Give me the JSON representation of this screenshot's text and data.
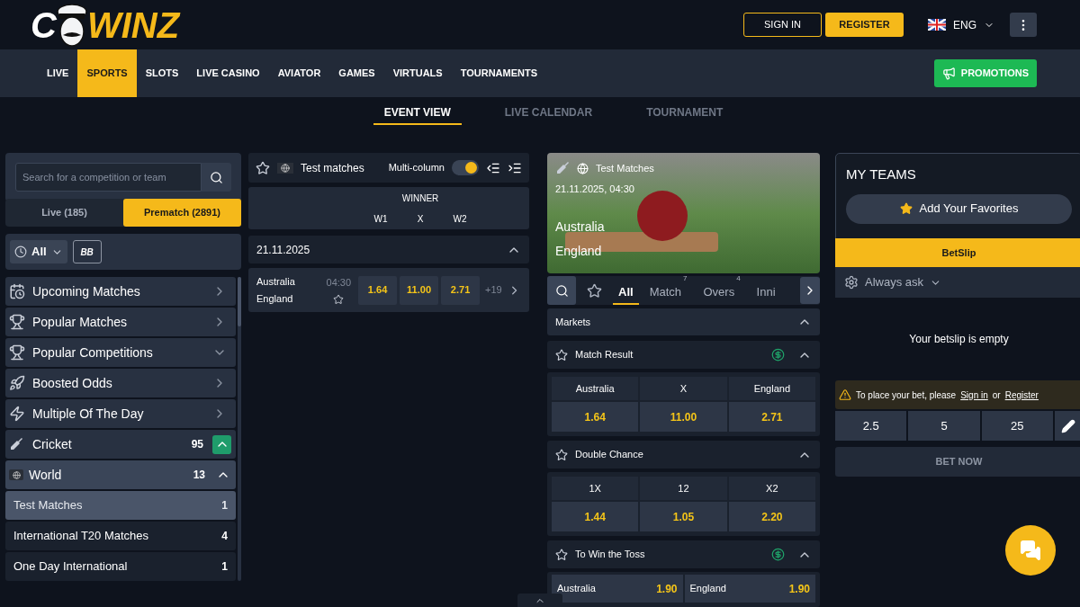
{
  "logo": {
    "left": "C",
    "right": "WINZ"
  },
  "header": {
    "sign_in": "SIGN IN",
    "register": "REGISTER",
    "language": "ENG"
  },
  "nav": [
    {
      "label": "LIVE",
      "selected": false
    },
    {
      "label": "SPORTS",
      "selected": true
    },
    {
      "label": "SLOTS",
      "selected": false
    },
    {
      "label": "LIVE CASINO",
      "selected": false
    },
    {
      "label": "AVIATOR",
      "selected": false
    },
    {
      "label": "GAMES",
      "selected": false
    },
    {
      "label": "VIRTUALS",
      "selected": false
    },
    {
      "label": "TOURNAMENTS",
      "selected": false
    }
  ],
  "promotions": "PROMOTIONS",
  "view_tabs": [
    {
      "label": "EVENT VIEW",
      "selected": true
    },
    {
      "label": "LIVE CALENDAR",
      "selected": false
    },
    {
      "label": "TOURNAMENT",
      "selected": false
    }
  ],
  "sidebar": {
    "search": {
      "placeholder": "Search for a competition or team"
    },
    "mode_tabs": [
      {
        "label": "Live (185)",
        "selected": false
      },
      {
        "label": "Prematch (2891)",
        "selected": true
      }
    ],
    "filter": {
      "label": "All",
      "bet_builder": "BB"
    },
    "items": [
      {
        "kind": "link",
        "label": "Upcoming Matches"
      },
      {
        "kind": "link",
        "label": "Popular Matches"
      },
      {
        "kind": "dropdown",
        "label": "Popular Competitions"
      },
      {
        "kind": "link",
        "label": "Boosted Odds"
      },
      {
        "kind": "link",
        "label": "Multiple Of The Day"
      },
      {
        "kind": "sport",
        "label": "Cricket",
        "count": "95",
        "expanded": true
      },
      {
        "kind": "region",
        "label": "World",
        "count": "13",
        "expanded": true
      },
      {
        "kind": "league",
        "label": "Test Matches",
        "count": "1",
        "selected": true
      },
      {
        "kind": "league",
        "label": "International T20 Matches",
        "count": "4",
        "selected": false
      },
      {
        "kind": "league",
        "label": "One Day International",
        "count": "1",
        "selected": false
      }
    ]
  },
  "events": {
    "title": "Test matches",
    "multicolumn": {
      "label": "Multi-column",
      "on": true
    },
    "market": {
      "title": "WINNER",
      "outcomes": [
        "W1",
        "X",
        "W2"
      ]
    },
    "date_group": {
      "date": "21.11.2025",
      "expanded": true
    },
    "matches": [
      {
        "home": "Australia",
        "away": "England",
        "time": "04:30",
        "odds": [
          "1.64",
          "11.00",
          "2.71"
        ],
        "more": "+19"
      }
    ]
  },
  "match": {
    "competition": "Test Matches",
    "datetime": "21.11.2025, 04:30",
    "home": "Australia",
    "away": "England",
    "tabs": [
      {
        "label": "All",
        "selected": true
      },
      {
        "label": "Match",
        "badge": "7",
        "selected": false
      },
      {
        "label": "Overs",
        "badge": "4",
        "selected": false
      },
      {
        "label": "Inni",
        "selected": false
      }
    ],
    "markets_header": {
      "title": "Markets",
      "expanded": true
    },
    "markets": [
      {
        "kind": "grid",
        "title": "Match Result",
        "cashout": true,
        "expanded": true,
        "outcomes": [
          {
            "label": "Australia",
            "odd": "1.64"
          },
          {
            "label": "X",
            "odd": "11.00"
          },
          {
            "label": "England",
            "odd": "2.71"
          }
        ]
      },
      {
        "kind": "grid",
        "title": "Double Chance",
        "cashout": false,
        "expanded": true,
        "outcomes": [
          {
            "label": "1X",
            "odd": "1.44"
          },
          {
            "label": "12",
            "odd": "1.05"
          },
          {
            "label": "X2",
            "odd": "2.20"
          }
        ]
      },
      {
        "kind": "inline",
        "title": "To Win the Toss",
        "cashout": true,
        "expanded": true,
        "outcomes": [
          {
            "label": "Australia",
            "odd": "1.90"
          },
          {
            "label": "England",
            "odd": "1.90"
          }
        ]
      }
    ]
  },
  "my_teams": {
    "title": "MY TEAMS",
    "button": "Add Your Favorites"
  },
  "betslip": {
    "tab": "BetSlip",
    "setting": "Always ask",
    "empty": "Your betslip is empty",
    "notice": {
      "text": "To place your bet, please",
      "sign_in": "Sign in",
      "or": "or",
      "register": "Register"
    },
    "stakes": [
      "2.5",
      "5",
      "25"
    ],
    "bet_now": "BET NOW"
  }
}
